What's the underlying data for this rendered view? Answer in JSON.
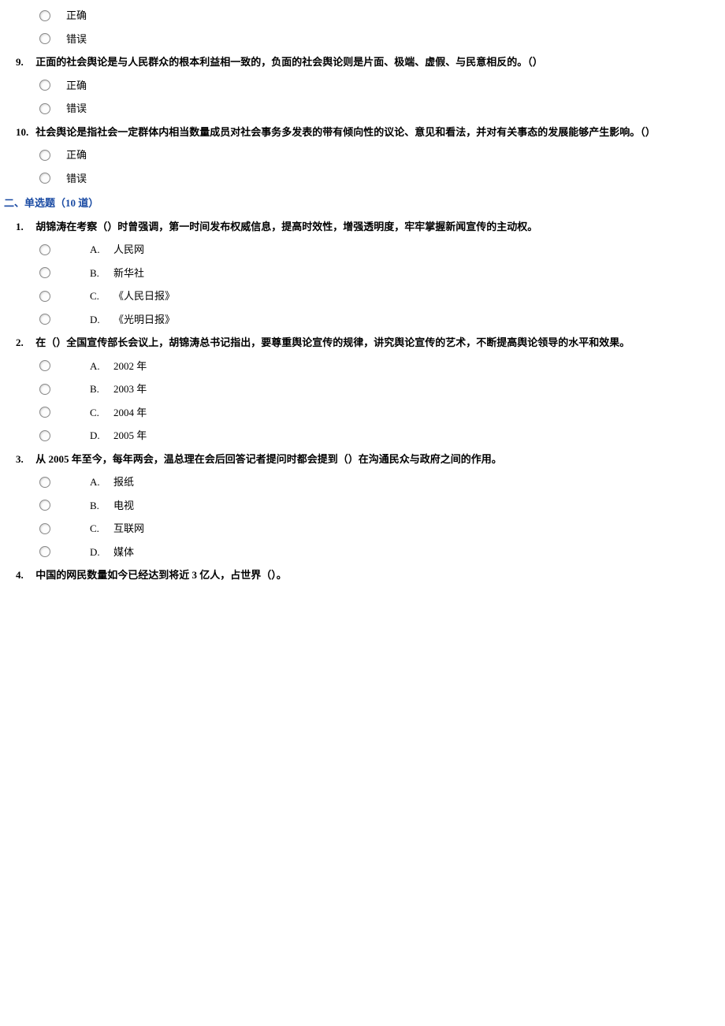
{
  "tf_section": {
    "q8": {
      "options": {
        "correct": "正确",
        "wrong": "错误"
      }
    },
    "q9": {
      "num": "9.",
      "text": "正面的社会舆论是与人民群众的根本利益相一致的，负面的社会舆论则是片面、极端、虚假、与民意相反的。（）",
      "options": {
        "correct": "正确",
        "wrong": "错误"
      }
    },
    "q10": {
      "num": "10.",
      "text": "社会舆论是指社会一定群体内相当数量成员对社会事务多发表的带有倾向性的议论、意见和看法，并对有关事态的发展能够产生影响。（）",
      "options": {
        "correct": "正确",
        "wrong": "错误"
      }
    }
  },
  "section2_header": "二、单选题（10 道）",
  "mc_section": {
    "q1": {
      "num": "1.",
      "text": "胡锦涛在考察（）时曾强调，第一时间发布权威信息，提高时效性，增强透明度，牢牢掌握新闻宣传的主动权。",
      "options": {
        "a": {
          "letter": "A.",
          "text": "人民网"
        },
        "b": {
          "letter": "B.",
          "text": "新华社"
        },
        "c": {
          "letter": "C.",
          "text": "《人民日报》"
        },
        "d": {
          "letter": "D.",
          "text": "《光明日报》"
        }
      }
    },
    "q2": {
      "num": "2.",
      "text": "在（）全国宣传部长会议上，胡锦涛总书记指出，要尊重舆论宣传的规律，讲究舆论宣传的艺术，不断提高舆论领导的水平和效果。",
      "options": {
        "a": {
          "letter": "A.",
          "text": "2002 年"
        },
        "b": {
          "letter": "B.",
          "text": "2003 年"
        },
        "c": {
          "letter": "C.",
          "text": "2004 年"
        },
        "d": {
          "letter": "D.",
          "text": "2005 年"
        }
      }
    },
    "q3": {
      "num": "3.",
      "text": "从 2005 年至今，每年两会，温总理在会后回答记者提问时都会提到（）在沟通民众与政府之间的作用。",
      "options": {
        "a": {
          "letter": "A.",
          "text": "报纸"
        },
        "b": {
          "letter": "B.",
          "text": "电视"
        },
        "c": {
          "letter": "C.",
          "text": "互联网"
        },
        "d": {
          "letter": "D.",
          "text": "媒体"
        }
      }
    },
    "q4": {
      "num": "4.",
      "text": "中国的网民数量如今已经达到将近 3 亿人，占世界（）。"
    }
  }
}
